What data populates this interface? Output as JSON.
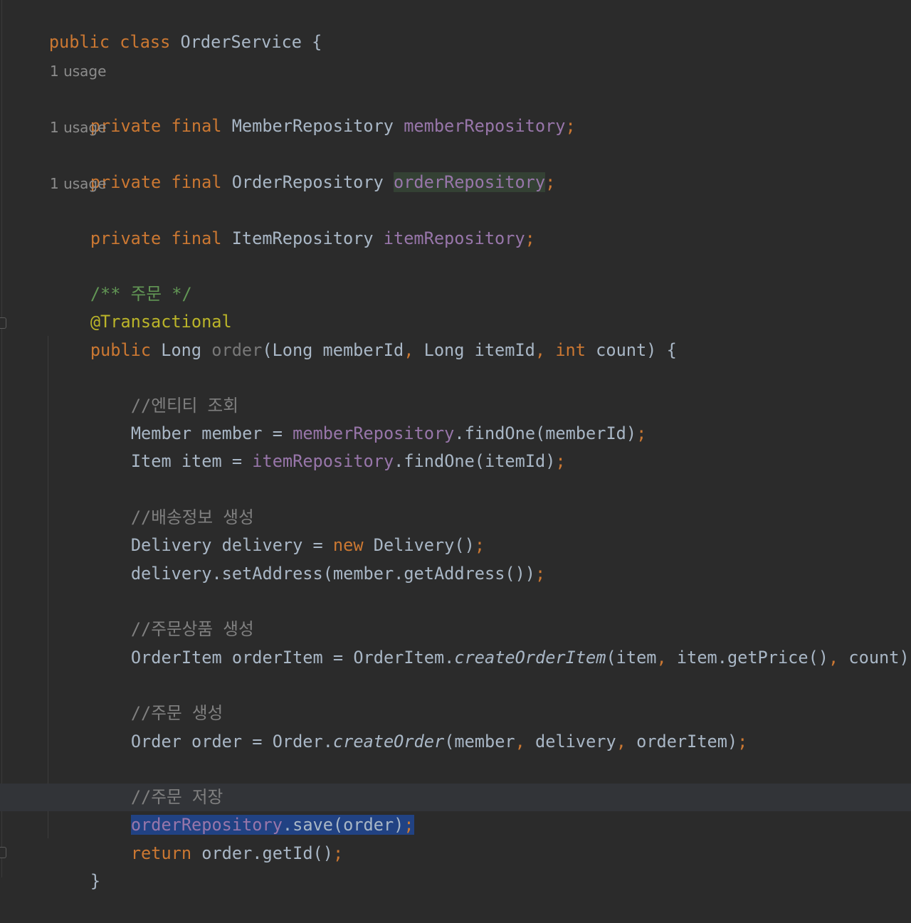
{
  "editor": {
    "code": [
      {
        "id": "l1",
        "tokens": [
          "public",
          " ",
          "class",
          " OrderService {"
        ]
      },
      {
        "id": "h1",
        "text": "1 usage"
      },
      {
        "id": "l2",
        "tokens": [
          "private",
          " ",
          "final",
          " MemberRepository ",
          "memberRepository",
          ";"
        ]
      },
      {
        "id": "h2",
        "text": "1 usage"
      },
      {
        "id": "l3",
        "tokens": [
          "private",
          " ",
          "final",
          " OrderRepository ",
          "orderRepository",
          ";"
        ]
      },
      {
        "id": "h3",
        "text": "1 usage"
      },
      {
        "id": "l4",
        "tokens": [
          "private",
          " ",
          "final",
          " ItemRepository ",
          "itemRepository",
          ";"
        ]
      },
      {
        "id": "l5",
        "tokens": [
          "/** 주문 */"
        ]
      },
      {
        "id": "l6",
        "tokens": [
          "@Transactional"
        ]
      },
      {
        "id": "l7",
        "tokens": [
          "public",
          " Long ",
          "order",
          "(Long memberId",
          ",",
          " Long itemId",
          ",",
          " ",
          "int",
          " count) {"
        ]
      },
      {
        "id": "l8",
        "tokens": [
          "//엔티티 조회"
        ]
      },
      {
        "id": "l9",
        "tokens": [
          "Member member = ",
          "memberRepository",
          ".findOne(memberId)",
          ";"
        ]
      },
      {
        "id": "l10",
        "tokens": [
          "Item item = ",
          "itemRepository",
          ".findOne(itemId)",
          ";"
        ]
      },
      {
        "id": "l11",
        "tokens": [
          "//배송정보 생성"
        ]
      },
      {
        "id": "l12",
        "tokens": [
          "Delivery delivery = ",
          "new",
          " Delivery()",
          ";"
        ]
      },
      {
        "id": "l13",
        "tokens": [
          "delivery.setAddress(member.getAddress())",
          ";"
        ]
      },
      {
        "id": "l14",
        "tokens": [
          "//주문상품 생성"
        ]
      },
      {
        "id": "l15",
        "tokens": [
          "OrderItem orderItem = OrderItem.",
          "createOrderItem",
          "(item",
          ",",
          " item.getPrice()",
          ",",
          " count)",
          ";"
        ]
      },
      {
        "id": "l16",
        "tokens": [
          "//주문 생성"
        ]
      },
      {
        "id": "l17",
        "tokens": [
          "Order order = Order.",
          "createOrder",
          "(member",
          ",",
          " delivery",
          ",",
          " orderItem)",
          ";"
        ]
      },
      {
        "id": "l18",
        "tokens": [
          "//주문 저장"
        ]
      },
      {
        "id": "l19",
        "tokens": [
          "orderRepository",
          ".save(order)",
          ";"
        ]
      },
      {
        "id": "l20",
        "tokens": [
          "return",
          " order.getId()",
          ";"
        ]
      },
      {
        "id": "l21",
        "tokens": [
          "}"
        ]
      }
    ]
  },
  "colors": {
    "background": "#2b2b2b",
    "keyword": "#cc7832",
    "field": "#9876aa",
    "comment": "#808080",
    "doc_comment": "#629755",
    "annotation": "#bbb529",
    "text": "#a9b7c6",
    "selection": "#214283",
    "read_highlight": "#344134"
  }
}
